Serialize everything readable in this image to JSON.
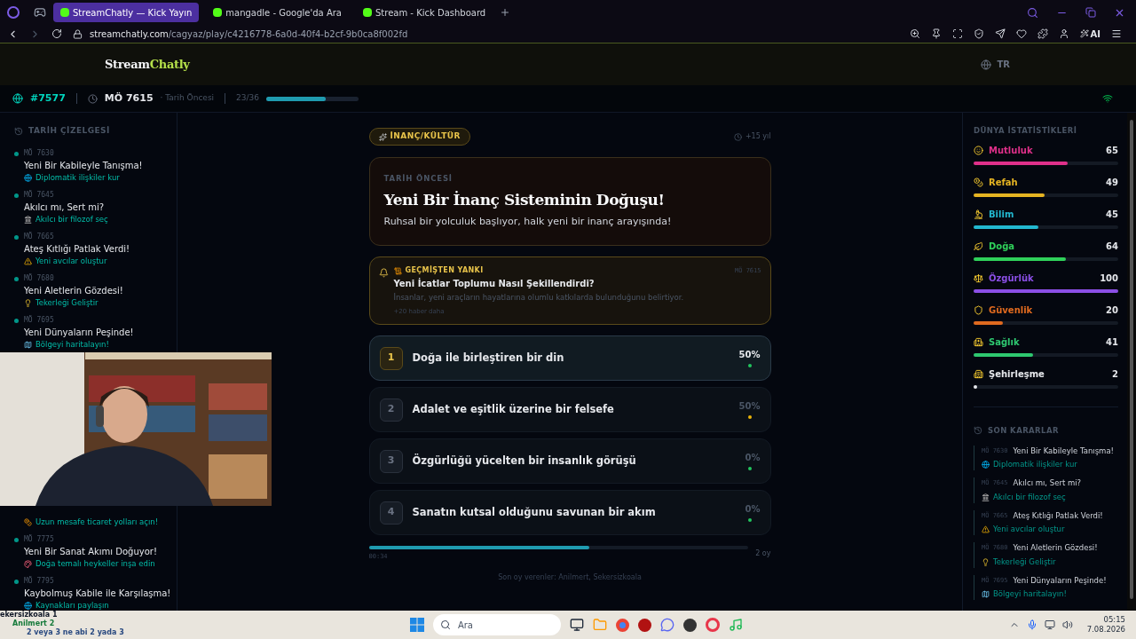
{
  "browser": {
    "tabs": [
      {
        "title": "StreamChatly — Kick Yayın",
        "selected": true
      },
      {
        "title": "mangadle - Google'da Ara",
        "selected": false
      },
      {
        "title": "Stream - Kick Dashboard",
        "selected": false
      }
    ],
    "url_domain": "streamchatly.com",
    "url_path": "/cagyaz/play/c4216778-6a0d-40f4-b2cf-9b0ca8f002fd",
    "toolbar_ai": "AI"
  },
  "header": {
    "logo_first": "Stream",
    "logo_second": "Chatly",
    "language": "TR"
  },
  "info_bar": {
    "game_id": "#7577",
    "year": "MÖ 7615",
    "era": "· Tarih Öncesi",
    "round": "23/36",
    "level": 0.64
  },
  "timeline": {
    "title": "TARİH ÇİZELGESİ",
    "items": [
      {
        "year": "MÖ 7630",
        "title": "Yeni Bir Kabileyle Tanışma!",
        "action": "Diplomatik ilişkiler kur"
      },
      {
        "year": "MÖ 7645",
        "title": "Akılcı mı, Sert mi?",
        "action": "Akılcı bir filozof seç"
      },
      {
        "year": "MÖ 7665",
        "title": "Ateş Kıtlığı Patlak Verdi!",
        "action": "Yeni avcılar oluştur"
      },
      {
        "year": "MÖ 7680",
        "title": "Yeni Aletlerin Gözdesi!",
        "action": "Tekerleği Geliştir"
      },
      {
        "year": "MÖ 7695",
        "title": "Yeni Dünyaların Peşinde!",
        "action": "Bölgeyi haritalayın!"
      },
      {
        "action": "Uzun mesafe ticaret yolları açın!"
      },
      {
        "year": "MÖ 7775",
        "title": "Yeni Bir Sanat Akımı Doğuyor!",
        "action": "Doğa temalı heykeller inşa edin"
      },
      {
        "year": "MÖ 7795",
        "title": "Kaybolmuş Kabile ile Karşılaşma!",
        "action": "Kaynakları paylaşın"
      }
    ]
  },
  "event": {
    "category": "İNANÇ/KÜLTÜR",
    "duration": "+15 yıl",
    "era": "TARİH ÖNCESİ",
    "title": "Yeni Bir İnanç Sisteminin Doğuşu!",
    "description": "Ruhsal bir yolculuk başlıyor, halk yeni bir inanç arayışında!"
  },
  "echo": {
    "label": "GEÇMİŞTEN YANKI",
    "year": "MÖ 7615",
    "title": "Yeni İcatlar Toplumu Nasıl Şekillendirdi?",
    "body": "İnsanlar, yeni araçların hayatlarına olumlu katkılarda bulunduğunu belirtiyor.",
    "more": "+20 haber daha"
  },
  "options": [
    {
      "number": "1",
      "text": "Doğa ile birleştiren bir din",
      "percent": "50%",
      "selected": true,
      "color": "#22c55e"
    },
    {
      "number": "2",
      "text": "Adalet ve eşitlik üzerine bir felsefe",
      "percent": "50%",
      "selected": false,
      "color": "#eab308"
    },
    {
      "number": "3",
      "text": "Özgürlüğü yücelten bir insanlık görüşü",
      "percent": "0%",
      "selected": false,
      "color": "#22c55e"
    },
    {
      "number": "4",
      "text": "Sanatın kutsal olduğunu savunan bir akım",
      "percent": "0%",
      "selected": false,
      "color": "#22c55e"
    }
  ],
  "timer": {
    "level": 0.58,
    "time": "00:34",
    "votes": "2 oy"
  },
  "recent_voters": "Son oy verenler: Anilmert, Sekersizkoala",
  "stats": {
    "title": "DÜNYA İSTATİSTİKLERİ",
    "items": [
      {
        "name": "Mutluluk",
        "value": "65",
        "level": 0.65,
        "color": "#e0308a"
      },
      {
        "name": "Refah",
        "value": "49",
        "level": 0.49,
        "color": "#e6b422"
      },
      {
        "name": "Bilim",
        "value": "45",
        "level": 0.45,
        "color": "#22b8cf"
      },
      {
        "name": "Doğa",
        "value": "64",
        "level": 0.64,
        "color": "#2fd15a"
      },
      {
        "name": "Özgürlük",
        "value": "100",
        "level": 1,
        "color": "#8b4fe6"
      },
      {
        "name": "Güvenlik",
        "value": "20",
        "level": 0.2,
        "color": "#e06a1f"
      },
      {
        "name": "Sağlık",
        "value": "41",
        "level": 0.41,
        "color": "#2ec870"
      },
      {
        "name": "Şehirleşme",
        "value": "2",
        "level": 0.02,
        "color": "#e5e7eb"
      }
    ]
  },
  "decisions": {
    "title": "SON KARARLAR",
    "items": [
      {
        "year": "MÖ 7630",
        "title": "Yeni Bir Kabileyle Tanışma!",
        "action": "Diplomatik ilişkiler kur"
      },
      {
        "year": "MÖ 7645",
        "title": "Akılcı mı, Sert mi?",
        "action": "Akılcı bir filozof seç"
      },
      {
        "year": "MÖ 7665",
        "title": "Ateş Kıtlığı Patlak Verdi!",
        "action": "Yeni avcılar oluştur"
      },
      {
        "year": "MÖ 7680",
        "title": "Yeni Aletlerin Gözdesi!",
        "action": "Tekerleği Geliştir"
      },
      {
        "year": "MÖ 7695",
        "title": "Yeni Dünyaların Peşinde!",
        "action": "Bölgeyi haritalayın!"
      }
    ]
  },
  "chat_overlay": [
    "ekersizkoala 1",
    "Anilmert 2",
    "2 veya 3 ne abi 2 yada 3"
  ],
  "taskbar": {
    "search_placeholder": "Ara",
    "time": "05:15",
    "date": "7.08.2026"
  }
}
